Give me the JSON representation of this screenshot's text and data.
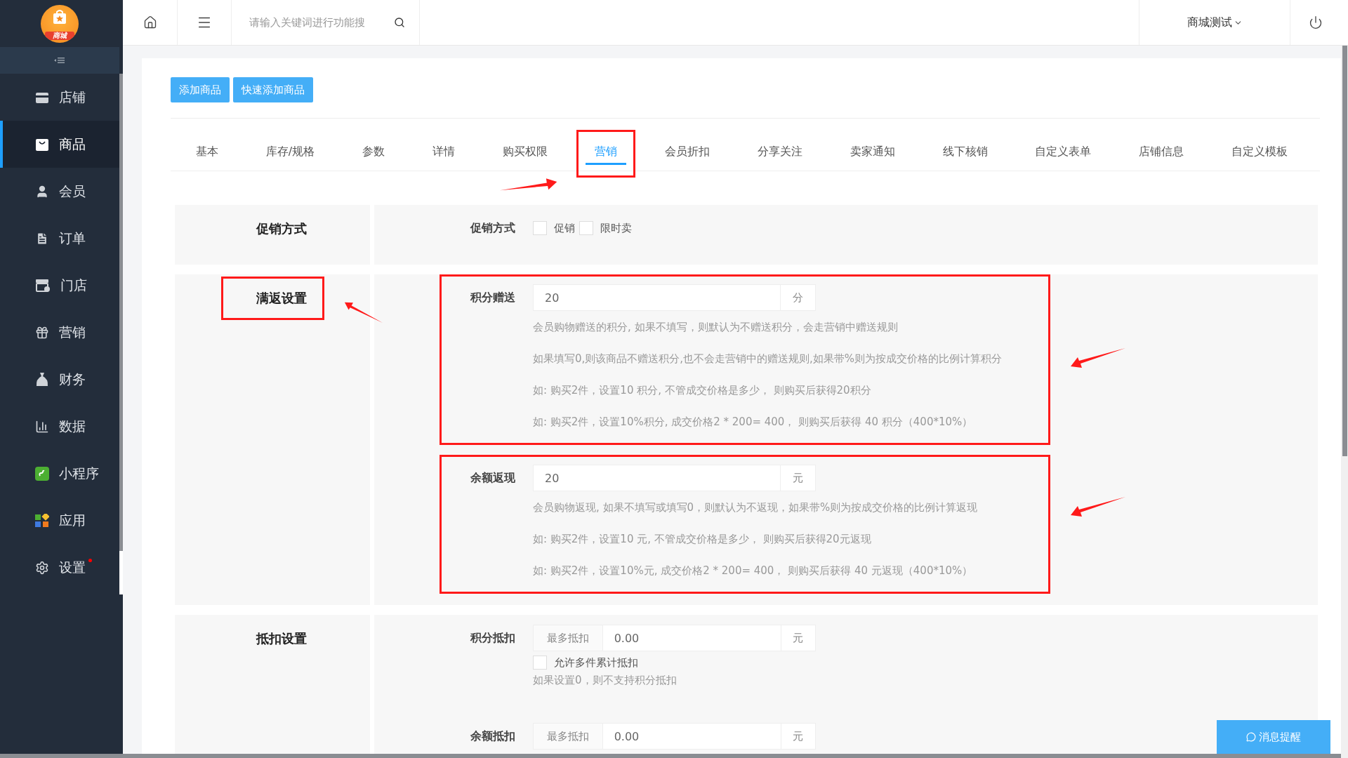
{
  "sidebar": {
    "logo_text": "商城",
    "items": [
      {
        "label": "店铺",
        "selected": false,
        "notice": false
      },
      {
        "label": "商品",
        "selected": true,
        "notice": false
      },
      {
        "label": "会员",
        "selected": false,
        "notice": false
      },
      {
        "label": "订单",
        "selected": false,
        "notice": false
      },
      {
        "label": "门店",
        "selected": false,
        "notice": false
      },
      {
        "label": "营销",
        "selected": false,
        "notice": false
      },
      {
        "label": "财务",
        "selected": false,
        "notice": false
      },
      {
        "label": "数据",
        "selected": false,
        "notice": false
      },
      {
        "label": "小程序",
        "selected": false,
        "notice": false
      },
      {
        "label": "应用",
        "selected": false,
        "notice": false
      },
      {
        "label": "设置",
        "selected": false,
        "notice": true
      }
    ]
  },
  "topbar": {
    "search": {
      "placeholder": "请输入关键词进行功能搜"
    },
    "shop": "商城测试"
  },
  "actions": [
    "添加商品",
    "快速添加商品"
  ],
  "tabs": [
    {
      "label": "基本",
      "selected": false,
      "highlighted": false
    },
    {
      "label": "库存/规格",
      "selected": false,
      "highlighted": false
    },
    {
      "label": "参数",
      "selected": false,
      "highlighted": false
    },
    {
      "label": "详情",
      "selected": false,
      "highlighted": false
    },
    {
      "label": "购买权限",
      "selected": false,
      "highlighted": false
    },
    {
      "label": "营销",
      "selected": true,
      "highlighted": true
    },
    {
      "label": "会员折扣",
      "selected": false,
      "highlighted": false
    },
    {
      "label": "分享关注",
      "selected": false,
      "highlighted": false
    },
    {
      "label": "卖家通知",
      "selected": false,
      "highlighted": false
    },
    {
      "label": "线下核销",
      "selected": false,
      "highlighted": false
    },
    {
      "label": "自定义表单",
      "selected": false,
      "highlighted": false
    },
    {
      "label": "店铺信息",
      "selected": false,
      "highlighted": false
    },
    {
      "label": "自定义模板",
      "selected": false,
      "highlighted": false
    }
  ],
  "sections": [
    {
      "title": "促销方式",
      "highlighted": false,
      "fields": [
        {
          "kind": "checkboxes",
          "label": "促销方式",
          "highlighted": false,
          "options": [
            {
              "label": "促销",
              "checked": false
            },
            {
              "label": "限时卖",
              "checked": false
            }
          ]
        }
      ]
    },
    {
      "title": "满返设置",
      "highlighted": true,
      "fields": [
        {
          "kind": "input",
          "label": "积分赠送",
          "value": "20",
          "unit": "分",
          "highlighted": true,
          "help": [
            "会员购物赠送的积分, 如果不填写，则默认为不赠送积分，会走营销中赠送规则",
            "如果填写0,则该商品不赠送积分,也不会走营销中的赠送规则,如果带%则为按成交价格的比例计算积分",
            "如: 购买2件，设置10 积分, 不管成交价格是多少， 则购买后获得20积分",
            "如: 购买2件，设置10%积分, 成交价格2 * 200= 400， 则购买后获得 40 积分（400*10%）"
          ]
        },
        {
          "kind": "input",
          "label": "余额返现",
          "value": "20",
          "unit": "元",
          "highlighted": true,
          "help": [
            "会员购物返现, 如果不填写或填写0，则默认为不返现，如果带%则为按成交价格的比例计算返现",
            "如: 购买2件，设置10 元, 不管成交价格是多少， 则购买后获得20元返现",
            "如: 购买2件，设置10%元, 成交价格2 * 200= 400， 则购买后获得 40 元返现（400*10%）"
          ]
        }
      ]
    },
    {
      "title": "抵扣设置",
      "highlighted": false,
      "fields": [
        {
          "kind": "deduct",
          "label": "积分抵扣",
          "prefix": "最多抵扣",
          "value": "0.00",
          "unit": "元",
          "highlighted": false,
          "option": {
            "label": "允许多件累计抵扣",
            "checked": false
          },
          "help": [
            "如果设置0，则不支持积分抵扣"
          ]
        },
        {
          "kind": "deduct",
          "label": "余额抵扣",
          "prefix": "最多抵扣",
          "value": "0.00",
          "unit": "元",
          "highlighted": false
        }
      ]
    }
  ],
  "message_button": "消息提醒"
}
